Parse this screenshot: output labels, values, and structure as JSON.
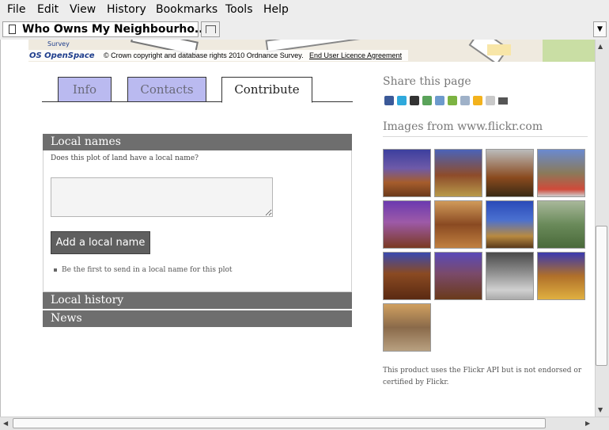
{
  "menu": {
    "items": [
      {
        "label": "File"
      },
      {
        "label": "Edit"
      },
      {
        "label": "View"
      },
      {
        "label": "History"
      },
      {
        "label": "Bookmarks"
      },
      {
        "label": "Tools"
      },
      {
        "label": "Help"
      }
    ]
  },
  "browser": {
    "tab_title": "Who Owns My Neighbourho..."
  },
  "map": {
    "logo_text": "OS OpenSpace",
    "logo_small": "Survey",
    "copyright": "© Crown copyright and database rights 2010 Ordnance Survey.",
    "licence_link": "End User Licence Agreement"
  },
  "tabs": {
    "info": "Info",
    "contacts": "Contacts",
    "contribute": "Contribute"
  },
  "local_names": {
    "heading": "Local names",
    "question": "Does this plot of land have a local name?",
    "input_value": "",
    "button": "Add a local name",
    "first_note": "Be the first to send in a local name for this plot"
  },
  "local_history": {
    "heading": "Local history"
  },
  "news": {
    "heading": "News"
  },
  "share": {
    "heading": "Share this page",
    "icons": [
      "facebook-icon",
      "twitter-icon",
      "myspace-icon",
      "stumbleupon-icon",
      "delicious-icon",
      "google-icon",
      "digg-icon",
      "favorites-icon",
      "email-icon",
      "print-icon"
    ]
  },
  "flickr": {
    "heading": "Images from www.flickr.com",
    "disclaimer": "This product uses the Flickr API but is not endorsed or certified by Flickr."
  },
  "colors": {
    "tab_inactive": "#babaf0",
    "panel_header": "#6e6e6e",
    "button": "#5f5f5f"
  }
}
